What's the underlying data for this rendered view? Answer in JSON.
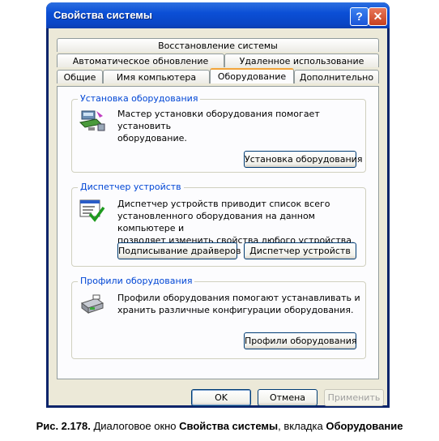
{
  "window": {
    "title": "Свойства системы",
    "help_glyph": "?",
    "close_glyph": "✕"
  },
  "tabs": {
    "row1": [
      "Восстановление системы"
    ],
    "row2": [
      "Автоматическое обновление",
      "Удаленное использование"
    ],
    "row3": [
      "Общие",
      "Имя компьютера",
      "Оборудование",
      "Дополнительно"
    ],
    "active": "Оборудование"
  },
  "groups": {
    "install": {
      "title": "Установка оборудования",
      "text_line1": "Мастер установки оборудования помогает установить",
      "text_line2": "оборудование.",
      "button": "Установка оборудования",
      "icon": "hardware-wizard-icon"
    },
    "device_manager": {
      "title": "Диспетчер устройств",
      "text_line1": "Диспетчер устройств приводит список всего",
      "text_line2": "установленного оборудования на данном компьютере и",
      "text_line3": "позволяет изменить свойства любого устройства.",
      "button_signing": "Подписывание драйверов",
      "button_manager": "Диспетчер устройств",
      "icon": "device-manager-icon"
    },
    "profiles": {
      "title": "Профили оборудования",
      "text_line1": "Профили оборудования помогают устанавливать и",
      "text_line2": "хранить различные конфигурации оборудования.",
      "button": "Профили оборудования",
      "icon": "hardware-profiles-icon"
    }
  },
  "footer": {
    "ok": "OK",
    "cancel": "Отмена",
    "apply": "Применить"
  },
  "caption": {
    "prefix": "Рис. 2.178.",
    "text1": " Диалоговое окно ",
    "bold1": "Свойства системы",
    "text2": ", вкладка ",
    "bold2": "Оборудование"
  },
  "colors": {
    "titlebar": "#0b4fd6",
    "dialog_bg": "#ece9d8",
    "group_title": "#0046d5",
    "active_tab_accent": "#f3a43a"
  }
}
